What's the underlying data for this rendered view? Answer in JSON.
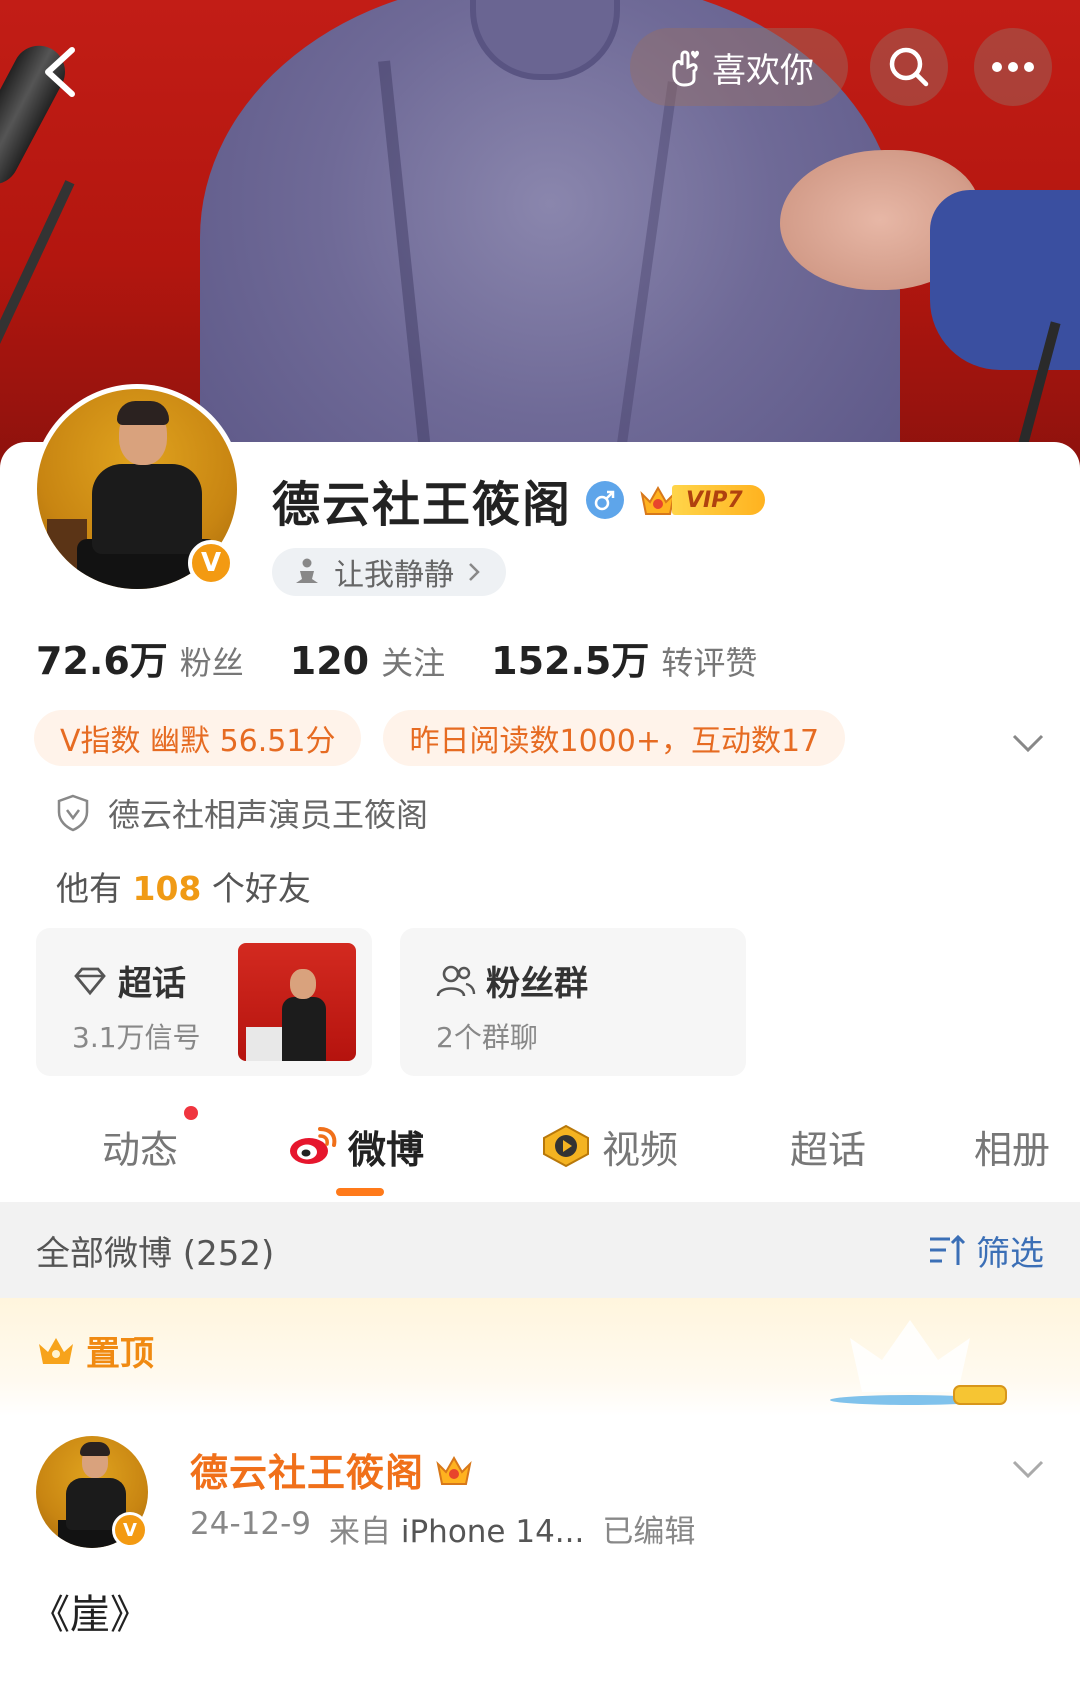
{
  "top_bar": {
    "like_label": "喜欢你"
  },
  "profile": {
    "name": "德云社王筱阁",
    "gender": "male",
    "vip_level": "VIP7",
    "signature": "让我静静",
    "stats": [
      {
        "value": "72.6万",
        "label": "粉丝"
      },
      {
        "value": "120",
        "label": "关注"
      },
      {
        "value": "152.5万",
        "label": "转评赞"
      }
    ],
    "chips": [
      {
        "text": "V指数 幽默 56.51分"
      },
      {
        "text": "昨日阅读数1000+，互动数17"
      }
    ],
    "verification": "德云社相声演员王筱阁",
    "friends": {
      "prefix": "他有",
      "count": "108",
      "suffix": "个好友"
    },
    "tiles": [
      {
        "title": "超话",
        "sub": "3.1万信号"
      },
      {
        "title": "粉丝群",
        "sub": "2个群聊"
      }
    ]
  },
  "tabs": [
    {
      "label": "动态",
      "has_dot": true
    },
    {
      "label": "微博",
      "active": true
    },
    {
      "label": "视频"
    },
    {
      "label": "超话"
    },
    {
      "label": "相册"
    }
  ],
  "feed": {
    "section_title": "全部微博 (252)",
    "filter_label": "筛选",
    "pinned_label": "置顶",
    "post": {
      "author": "德云社王筱阁",
      "date": "24-12-9",
      "source": "来自",
      "device": "iPhone 14...",
      "edited": "已编辑",
      "text": "《崖》"
    }
  },
  "colors": {
    "accent_orange": "#ff7a1a",
    "name_orange": "#f0701a",
    "link_blue": "#3b6fb6",
    "cover_red": "#c21d16"
  }
}
